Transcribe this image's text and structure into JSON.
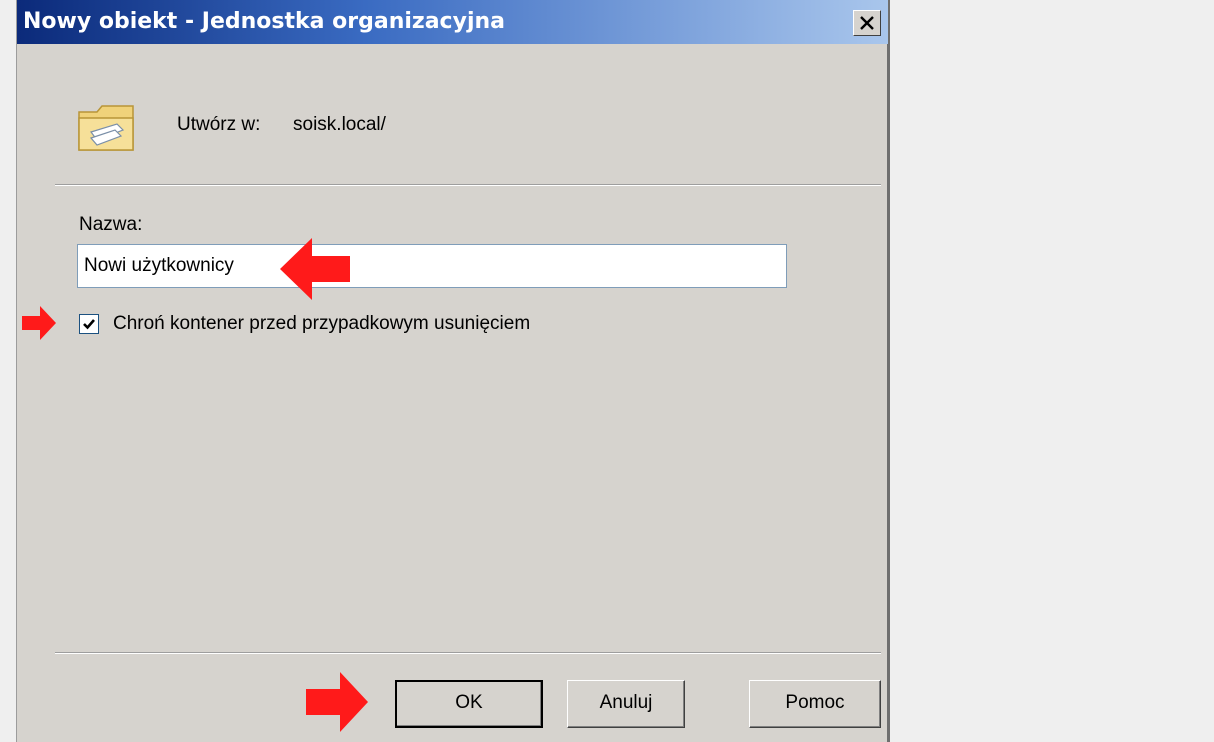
{
  "window": {
    "title": "Nowy obiekt - Jednostka organizacyjna"
  },
  "create_in": {
    "label": "Utwórz w:",
    "value": "soisk.local/"
  },
  "name_field": {
    "label": "Nazwa:",
    "value": "Nowi użytkownicy"
  },
  "protect_checkbox": {
    "label": "Chroń kontener przed przypadkowym usunięciem",
    "checked": true
  },
  "buttons": {
    "ok": "OK",
    "cancel": "Anuluj",
    "help": "Pomoc"
  },
  "colors": {
    "annotation_arrow": "#ff1a1a",
    "dialog_bg": "#d6d3ce"
  },
  "icons": {
    "object_icon": "organizational-unit-folder-icon",
    "close": "close-icon"
  }
}
